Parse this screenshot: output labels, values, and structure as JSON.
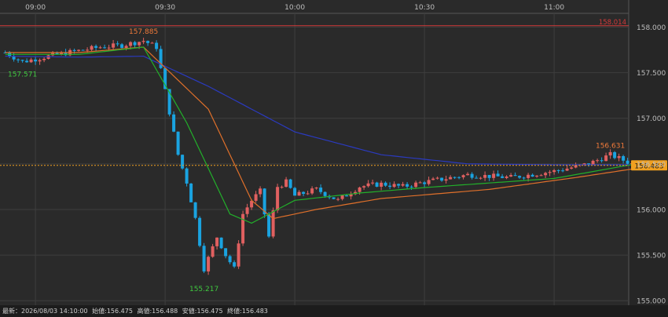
{
  "chart_data": {
    "type": "candlestick",
    "x_ticks": [
      "09:00",
      "09:30",
      "10:00",
      "10:30",
      "11:00"
    ],
    "y_ticks": [
      "158.000",
      "157.500",
      "157.000",
      "156.500",
      "156.000",
      "155.500",
      "155.000"
    ],
    "ylim": [
      154.95,
      158.15
    ],
    "grid": true,
    "horizontal_line": {
      "value": 158.014,
      "label": "158.014",
      "color": "#d43a3a"
    },
    "current_price": {
      "value": 156.483,
      "label": "156.483",
      "color": "#f0a020"
    },
    "annotations": [
      {
        "label": "157.885",
        "value": 157.885,
        "time": "09:25",
        "color": "#f07a3a"
      },
      {
        "label": "157.571",
        "value": 157.571,
        "time": "08:57",
        "color": "#3fc83f"
      },
      {
        "label": "155.217",
        "value": 155.217,
        "time": "09:39",
        "color": "#3fc83f"
      },
      {
        "label": "156.631",
        "value": 156.631,
        "time": "11:13",
        "color": "#f07a3a"
      }
    ],
    "anchors": [
      [
        "08:53",
        157.72
      ],
      [
        "08:57",
        157.62
      ],
      [
        "09:05",
        157.7
      ],
      [
        "09:15",
        157.78
      ],
      [
        "09:20",
        157.8
      ],
      [
        "09:25",
        157.85
      ],
      [
        "09:28",
        157.78
      ],
      [
        "09:30",
        157.3
      ],
      [
        "09:33",
        156.6
      ],
      [
        "09:35",
        156.3
      ],
      [
        "09:37",
        155.9
      ],
      [
        "09:39",
        155.35
      ],
      [
        "09:42",
        155.7
      ],
      [
        "09:44",
        155.5
      ],
      [
        "09:46",
        155.35
      ],
      [
        "09:48",
        155.95
      ],
      [
        "09:50",
        156.1
      ],
      [
        "09:52",
        156.2
      ],
      [
        "09:54",
        155.7
      ],
      [
        "09:56",
        156.25
      ],
      [
        "09:58",
        156.3
      ],
      [
        "10:00",
        156.15
      ],
      [
        "10:05",
        156.22
      ],
      [
        "10:10",
        156.1
      ],
      [
        "10:15",
        156.25
      ],
      [
        "10:20",
        156.28
      ],
      [
        "10:25",
        156.25
      ],
      [
        "10:30",
        156.3
      ],
      [
        "10:40",
        156.38
      ],
      [
        "10:50",
        156.35
      ],
      [
        "11:00",
        156.42
      ],
      [
        "11:08",
        156.5
      ],
      [
        "11:13",
        156.6
      ],
      [
        "11:17",
        156.52
      ],
      [
        "11:19",
        156.483
      ]
    ],
    "ma_fast": [
      [
        "08:53",
        157.7
      ],
      [
        "09:10",
        157.7
      ],
      [
        "09:25",
        157.78
      ],
      [
        "09:35",
        156.95
      ],
      [
        "09:45",
        155.95
      ],
      [
        "09:50",
        155.85
      ],
      [
        "10:00",
        156.1
      ],
      [
        "10:15",
        156.18
      ],
      [
        "10:30",
        156.24
      ],
      [
        "11:00",
        156.34
      ],
      [
        "11:19",
        156.5
      ]
    ],
    "ma_mid": [
      [
        "08:53",
        157.72
      ],
      [
        "09:10",
        157.72
      ],
      [
        "09:25",
        157.78
      ],
      [
        "09:40",
        157.1
      ],
      [
        "09:50",
        156.1
      ],
      [
        "09:55",
        155.9
      ],
      [
        "10:05",
        156.0
      ],
      [
        "10:20",
        156.12
      ],
      [
        "10:45",
        156.22
      ],
      [
        "11:05",
        156.35
      ],
      [
        "11:19",
        156.45
      ]
    ],
    "ma_slow": [
      [
        "08:53",
        157.68
      ],
      [
        "09:10",
        157.67
      ],
      [
        "09:25",
        157.68
      ],
      [
        "09:40",
        157.35
      ],
      [
        "10:00",
        156.85
      ],
      [
        "10:20",
        156.6
      ],
      [
        "10:40",
        156.5
      ],
      [
        "11:00",
        156.49
      ],
      [
        "11:19",
        156.49
      ]
    ]
  },
  "status": {
    "latest": "最新：2026/08/03 14:10:00",
    "open": "始値:156.475",
    "high": "高値:156.488",
    "low": "安値:156.475",
    "close": "終値:156.483"
  },
  "colors": {
    "up": "#e06060",
    "down": "#1aa3e0",
    "ma_fast": "#22b02a",
    "ma_mid": "#e0702a",
    "ma_slow": "#2a3ac0"
  }
}
